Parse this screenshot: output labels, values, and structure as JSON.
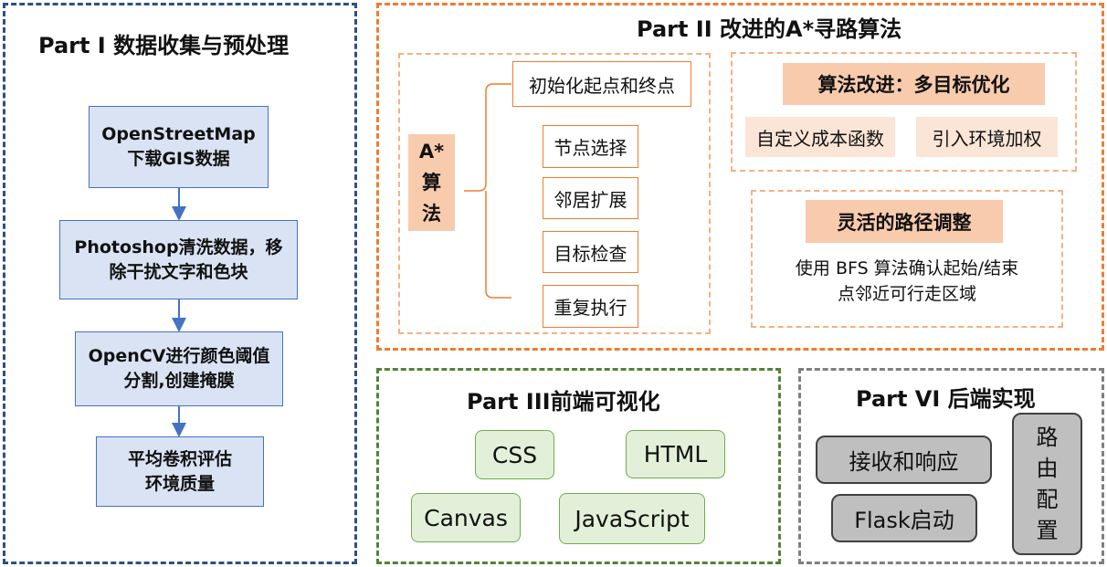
{
  "part1": {
    "title": "Part I 数据收集与预处理",
    "steps": [
      {
        "line1": "OpenStreetMap",
        "line2": "下载GIS数据"
      },
      {
        "line1": "Photoshop清洗数据，移",
        "line2": "除干扰文字和色块"
      },
      {
        "line1": "OpenCV进行颜色阈值",
        "line2": "分割,创建掩膜"
      },
      {
        "line1": "平均卷积评估",
        "line2": "环境质量"
      }
    ]
  },
  "part2": {
    "title": "Part II 改进的A*寻路算法",
    "astar_label": [
      "A*",
      "算",
      "法"
    ],
    "steps": [
      "初始化起点和终点",
      "节点选择",
      "邻居扩展",
      "目标检查",
      "重复执行"
    ],
    "improvement": {
      "title": "算法改进：多目标优化",
      "items": [
        "自定义成本函数",
        "引入环境加权"
      ]
    },
    "adjust": {
      "title": "灵活的路径调整",
      "line1": "使用 BFS 算法确认起始/结束",
      "line2": "点邻近可行走区域"
    }
  },
  "part3": {
    "title": "Part III前端可视化",
    "items": [
      "CSS",
      "HTML",
      "Canvas",
      "JavaScript"
    ]
  },
  "part4": {
    "title": "Part VI 后端实现",
    "items": [
      "接收和响应",
      "Flask启动"
    ],
    "route": [
      "路",
      "由",
      "配",
      "置"
    ]
  },
  "colors": {
    "part1_border": "#2f4f7f",
    "part2_border": "#ed7d31",
    "part3_border": "#548235",
    "part4_border": "#7f7f7f",
    "flow_fill": "#dae3f3",
    "flow_border": "#4472c4",
    "tag_fill": "#f8cbad",
    "tech_fill": "#e2f0d9",
    "gray_fill": "#bfbfbf"
  }
}
